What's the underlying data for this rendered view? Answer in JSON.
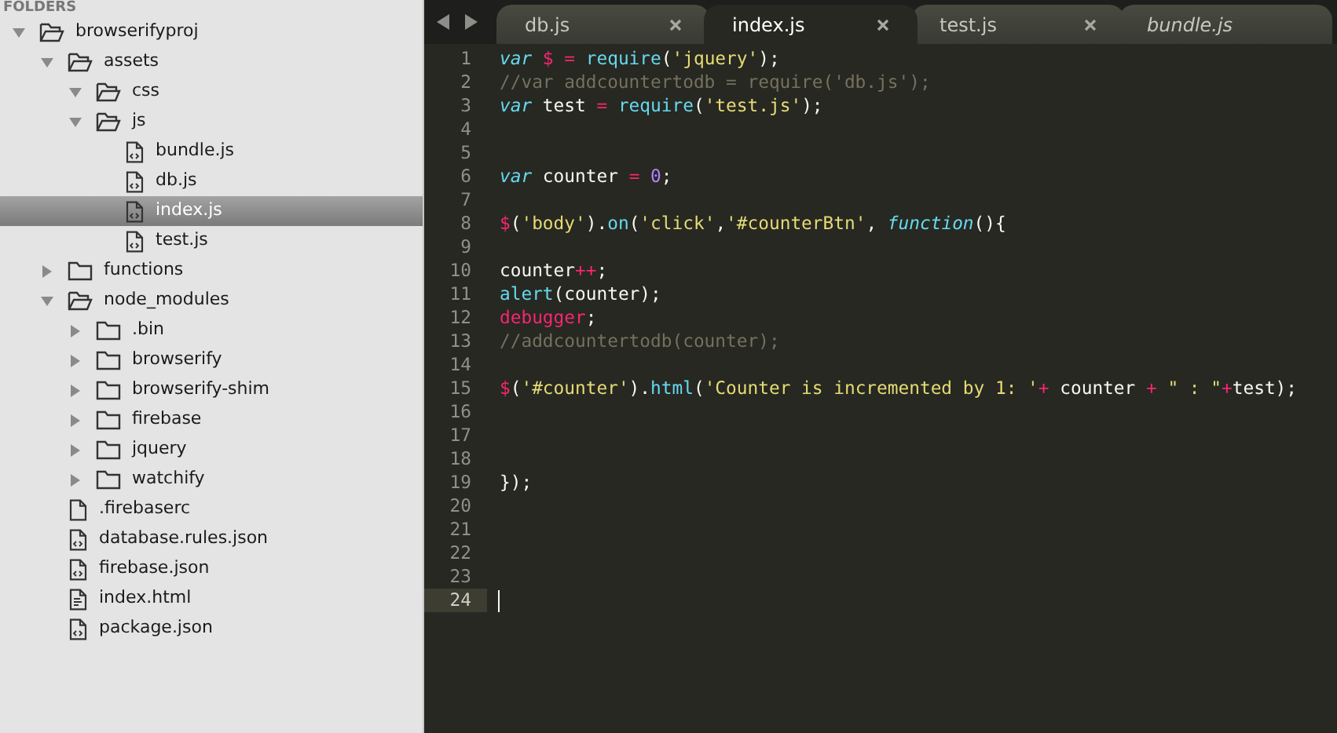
{
  "sidebar": {
    "header": "FOLDERS",
    "tree": [
      {
        "kind": "folder",
        "name": "browserifyproj",
        "expanded": true,
        "selected": false,
        "children": [
          {
            "kind": "folder",
            "name": "assets",
            "expanded": true,
            "selected": false,
            "children": [
              {
                "kind": "folder",
                "name": "css",
                "expanded": true,
                "selected": false
              },
              {
                "kind": "folder",
                "name": "js",
                "expanded": true,
                "selected": false,
                "children": [
                  {
                    "kind": "code-file",
                    "name": "bundle.js",
                    "selected": false
                  },
                  {
                    "kind": "code-file",
                    "name": "db.js",
                    "selected": false
                  },
                  {
                    "kind": "code-file",
                    "name": "index.js",
                    "selected": true
                  },
                  {
                    "kind": "code-file",
                    "name": "test.js",
                    "selected": false
                  }
                ]
              }
            ]
          },
          {
            "kind": "folder",
            "name": "functions",
            "expanded": false,
            "selected": false
          },
          {
            "kind": "folder",
            "name": "node_modules",
            "expanded": true,
            "selected": false,
            "children": [
              {
                "kind": "folder",
                "name": ".bin",
                "expanded": false,
                "selected": false
              },
              {
                "kind": "folder",
                "name": "browserify",
                "expanded": false,
                "selected": false
              },
              {
                "kind": "folder",
                "name": "browserify-shim",
                "expanded": false,
                "selected": false
              },
              {
                "kind": "folder",
                "name": "firebase",
                "expanded": false,
                "selected": false
              },
              {
                "kind": "folder",
                "name": "jquery",
                "expanded": false,
                "selected": false
              },
              {
                "kind": "folder",
                "name": "watchify",
                "expanded": false,
                "selected": false
              }
            ]
          },
          {
            "kind": "plain-file",
            "name": ".firebaserc",
            "selected": false
          },
          {
            "kind": "code-file",
            "name": "database.rules.json",
            "selected": false
          },
          {
            "kind": "code-file",
            "name": "firebase.json",
            "selected": false
          },
          {
            "kind": "markup-file",
            "name": "index.html",
            "selected": false
          },
          {
            "kind": "code-file",
            "name": "package.json",
            "selected": false
          }
        ]
      }
    ]
  },
  "tabs": [
    {
      "label": "db.js",
      "selected": false,
      "preview": false,
      "closable": true
    },
    {
      "label": "index.js",
      "selected": true,
      "preview": false,
      "closable": true
    },
    {
      "label": "test.js",
      "selected": false,
      "preview": false,
      "closable": true
    },
    {
      "label": "bundle.js",
      "selected": false,
      "preview": true,
      "closable": false
    }
  ],
  "editor": {
    "lines": [
      {
        "number": "1",
        "current": false,
        "tokens": [
          {
            "kind": "keyword",
            "text": "var"
          },
          {
            "kind": "op",
            "text": " $ = "
          },
          {
            "kind": "func",
            "text": "require"
          },
          {
            "kind": "plain",
            "text": "("
          },
          {
            "kind": "string",
            "text": "'jquery'"
          },
          {
            "kind": "plain",
            "text": ");"
          }
        ]
      },
      {
        "number": "2",
        "current": false,
        "tokens": [
          {
            "kind": "comment",
            "text": "//var addcountertodb = require('db.js');"
          }
        ]
      },
      {
        "number": "3",
        "current": false,
        "tokens": [
          {
            "kind": "keyword",
            "text": "var"
          },
          {
            "kind": "plain",
            "text": " test "
          },
          {
            "kind": "op",
            "text": "= "
          },
          {
            "kind": "func",
            "text": "require"
          },
          {
            "kind": "plain",
            "text": "("
          },
          {
            "kind": "string",
            "text": "'test.js'"
          },
          {
            "kind": "plain",
            "text": ");"
          }
        ]
      },
      {
        "number": "4",
        "current": false
      },
      {
        "number": "5",
        "current": false
      },
      {
        "number": "6",
        "current": false,
        "tokens": [
          {
            "kind": "keyword",
            "text": "var"
          },
          {
            "kind": "plain",
            "text": " counter "
          },
          {
            "kind": "op",
            "text": "= "
          },
          {
            "kind": "number",
            "text": "0"
          },
          {
            "kind": "plain",
            "text": ";"
          }
        ]
      },
      {
        "number": "7",
        "current": false
      },
      {
        "number": "8",
        "current": false,
        "tokens": [
          {
            "kind": "op",
            "text": "$"
          },
          {
            "kind": "plain",
            "text": "("
          },
          {
            "kind": "string",
            "text": "'body'"
          },
          {
            "kind": "plain",
            "text": ")."
          },
          {
            "kind": "func",
            "text": "on"
          },
          {
            "kind": "plain",
            "text": "("
          },
          {
            "kind": "string",
            "text": "'click'"
          },
          {
            "kind": "plain",
            "text": ","
          },
          {
            "kind": "string",
            "text": "'#counterBtn'"
          },
          {
            "kind": "plain",
            "text": ", "
          },
          {
            "kind": "keyword",
            "text": "function"
          },
          {
            "kind": "plain",
            "text": "(){"
          }
        ]
      },
      {
        "number": "9",
        "current": false
      },
      {
        "number": "10",
        "current": false,
        "tokens": [
          {
            "kind": "plain",
            "text": "counter"
          },
          {
            "kind": "op",
            "text": "++"
          },
          {
            "kind": "plain",
            "text": ";"
          }
        ]
      },
      {
        "number": "11",
        "current": false,
        "tokens": [
          {
            "kind": "func",
            "text": "alert"
          },
          {
            "kind": "plain",
            "text": "(counter);"
          }
        ]
      },
      {
        "number": "12",
        "current": false,
        "tokens": [
          {
            "kind": "op",
            "text": "debugger"
          },
          {
            "kind": "plain",
            "text": ";"
          }
        ]
      },
      {
        "number": "13",
        "current": false,
        "tokens": [
          {
            "kind": "comment",
            "text": "//addcountertodb(counter);"
          }
        ]
      },
      {
        "number": "14",
        "current": false
      },
      {
        "number": "15",
        "current": false,
        "tokens": [
          {
            "kind": "op",
            "text": "$"
          },
          {
            "kind": "plain",
            "text": "("
          },
          {
            "kind": "string",
            "text": "'#counter'"
          },
          {
            "kind": "plain",
            "text": ")."
          },
          {
            "kind": "func",
            "text": "html"
          },
          {
            "kind": "plain",
            "text": "("
          },
          {
            "kind": "string",
            "text": "'Counter is incremented by 1: '"
          },
          {
            "kind": "op",
            "text": "+"
          },
          {
            "kind": "plain",
            "text": " counter "
          },
          {
            "kind": "op",
            "text": "+ "
          },
          {
            "kind": "string",
            "text": "\" : \""
          },
          {
            "kind": "op",
            "text": "+"
          },
          {
            "kind": "plain",
            "text": "test);"
          }
        ]
      },
      {
        "number": "16",
        "current": false
      },
      {
        "number": "17",
        "current": false
      },
      {
        "number": "18",
        "current": false
      },
      {
        "number": "19",
        "current": false,
        "tokens": [
          {
            "kind": "plain",
            "text": "});"
          }
        ]
      },
      {
        "number": "20",
        "current": false
      },
      {
        "number": "21",
        "current": false
      },
      {
        "number": "22",
        "current": false
      },
      {
        "number": "23",
        "current": false
      },
      {
        "number": "24",
        "current": true
      }
    ]
  }
}
